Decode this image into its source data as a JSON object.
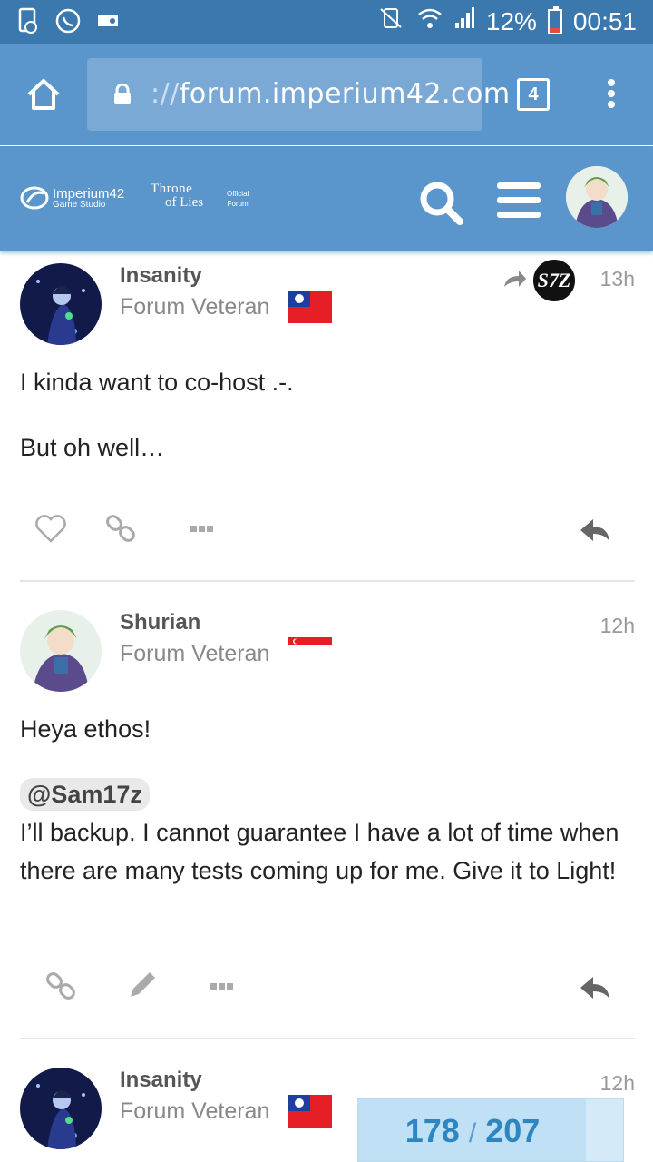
{
  "status_bar": {
    "battery": "12%",
    "time": "00:51",
    "left_icons": [
      "sim-icon",
      "whatsapp-icon",
      "game-icon"
    ],
    "right_icons": [
      "mute-icon",
      "wifi-icon",
      "signal-icon",
      "battery-icon"
    ]
  },
  "browser": {
    "url_scheme": "://",
    "url_host": "forum.imperium42.com",
    "tab_count": "4"
  },
  "site_header": {
    "logo1_main": "Imperium42",
    "logo1_sub": "Game Studio",
    "logo2_line1": "Throne",
    "logo2_line2": "of Lies",
    "logo3_line1": "Official",
    "logo3_line2": "Forum"
  },
  "posts": [
    {
      "author": "Insanity",
      "role": "Forum Veteran",
      "flag": "taiwan",
      "time": "13h",
      "reply_to": "S7Z",
      "paragraphs": [
        "I kinda want to co-host .-.",
        "But oh well…"
      ]
    },
    {
      "author": "Shurian",
      "role": "Forum Veteran",
      "flag": "singapore",
      "time": "12h",
      "paragraphs": [
        "Heya ethos!"
      ],
      "mention": "@Sam17z",
      "quote_text": "I’ll backup. I cannot guarantee I have a lot of time when there are many tests coming up for me. Give it to Light!"
    },
    {
      "author": "Insanity",
      "role": "Forum Veteran",
      "flag": "taiwan",
      "time": "12h"
    }
  ],
  "progress": {
    "current": "178",
    "separator": "/",
    "total": "207"
  },
  "colors": {
    "status_bar": "#3b78ae",
    "toolbar": "#5a96cc",
    "accent": "#2e86c1"
  }
}
